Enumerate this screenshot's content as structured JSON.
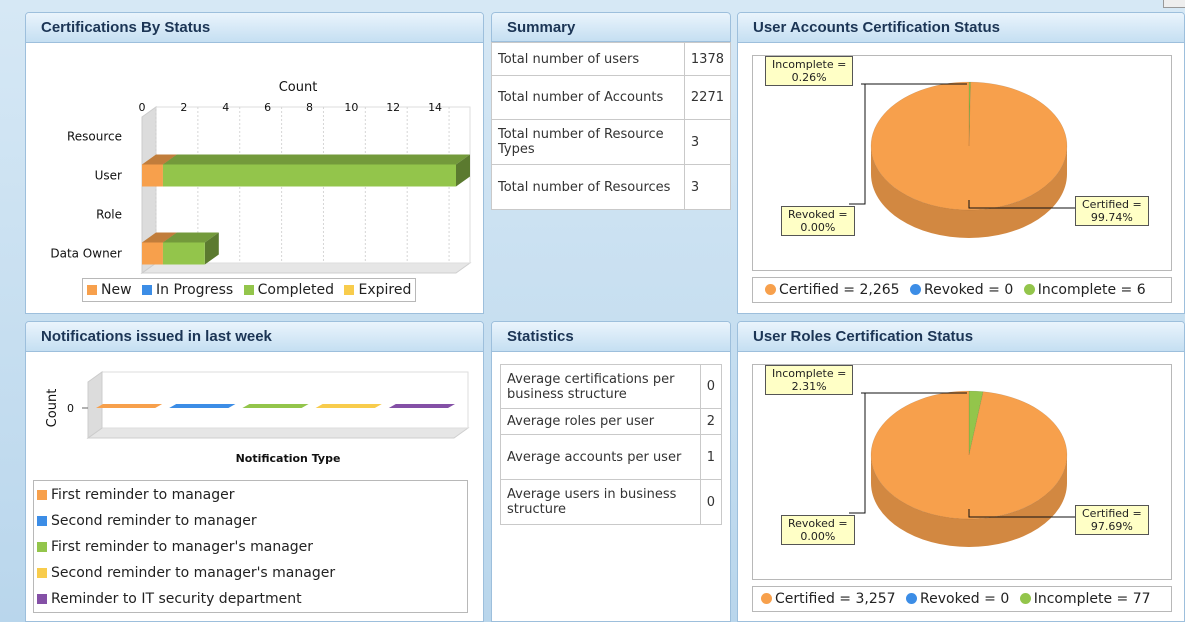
{
  "colors": {
    "new": "#f7a04c",
    "in_progress": "#3c8de6",
    "completed": "#93c54b",
    "expired": "#f8cc4c",
    "it_security": "#8450a6",
    "pie_orange": "#f7a04c",
    "pie_green": "#93c54b",
    "header_text": "#1c3555"
  },
  "cert_panel": {
    "title": "Certifications By Status",
    "legend": [
      {
        "label": "New",
        "color_key": "new"
      },
      {
        "label": "In Progress",
        "color_key": "in_progress"
      },
      {
        "label": "Completed",
        "color_key": "completed"
      },
      {
        "label": "Expired",
        "color_key": "expired"
      }
    ]
  },
  "summary_panel": {
    "title": "Summary",
    "rows": [
      {
        "label": "Total number of users",
        "value": "1378"
      },
      {
        "label": "Total number of Accounts",
        "value": "2271"
      },
      {
        "label": "Total number of Resource Types",
        "value": "3"
      },
      {
        "label": "Total number of Resources",
        "value": "3"
      }
    ]
  },
  "ua_panel": {
    "title": "User Accounts Certification Status",
    "callouts": {
      "incomplete": "Incomplete =\n0.26%",
      "revoked": "Revoked =\n0.00%",
      "certified": "Certified =\n99.74%"
    },
    "legend": [
      {
        "label": "Certified = 2,265",
        "color_key": "pie_orange"
      },
      {
        "label": "Revoked = 0",
        "color_key": "in_progress"
      },
      {
        "label": "Incomplete = 6",
        "color_key": "pie_green"
      }
    ]
  },
  "notif_panel": {
    "title": "Notifications issued in last week",
    "legend": [
      {
        "label": "First reminder to manager",
        "color_key": "new"
      },
      {
        "label": "Second reminder to manager",
        "color_key": "in_progress"
      },
      {
        "label": "First reminder to manager's manager",
        "color_key": "completed"
      },
      {
        "label": "Second reminder to manager's manager",
        "color_key": "expired"
      },
      {
        "label": "Reminder to IT security department",
        "color_key": "it_security"
      }
    ]
  },
  "stats_panel": {
    "title": "Statistics",
    "rows": [
      {
        "label": "Average certifications per business structure",
        "value": "0"
      },
      {
        "label": "Average roles per user",
        "value": "2"
      },
      {
        "label": "Average accounts per user",
        "value": "1"
      },
      {
        "label": "Average users in business structure",
        "value": "0"
      }
    ]
  },
  "ur_panel": {
    "title": "User Roles Certification Status",
    "callouts": {
      "incomplete": "Incomplete =\n2.31%",
      "revoked": "Revoked =\n0.00%",
      "certified": "Certified =\n97.69%"
    },
    "legend": [
      {
        "label": "Certified = 3,257",
        "color_key": "pie_orange"
      },
      {
        "label": "Revoked = 0",
        "color_key": "in_progress"
      },
      {
        "label": "Incomplete = 77",
        "color_key": "pie_green"
      }
    ]
  },
  "chart_data": [
    {
      "type": "bar",
      "orientation": "horizontal",
      "stacked": true,
      "xlabel": "Count",
      "xlim": [
        0,
        15
      ],
      "xticks": [
        0,
        2,
        4,
        6,
        8,
        10,
        12,
        14
      ],
      "categories": [
        "Resource",
        "User",
        "Role",
        "Data Owner"
      ],
      "series": [
        {
          "name": "New",
          "color_key": "new",
          "values": [
            0,
            1,
            0,
            1
          ]
        },
        {
          "name": "In Progress",
          "color_key": "in_progress",
          "values": [
            0,
            0,
            0,
            0
          ]
        },
        {
          "name": "Completed",
          "color_key": "completed",
          "values": [
            0,
            14,
            0,
            2
          ]
        },
        {
          "name": "Expired",
          "color_key": "expired",
          "values": [
            0,
            0,
            0,
            0
          ]
        }
      ],
      "legend_position": "bottom"
    },
    {
      "type": "bar",
      "orientation": "vertical",
      "ylabel": "Count",
      "xlabel": "Notification Type",
      "yticks": [
        0
      ],
      "categories": [
        "First reminder to manager",
        "Second reminder to manager",
        "First reminder to manager's manager",
        "Second reminder to manager's manager",
        "Reminder to IT security department"
      ],
      "values": [
        0,
        0,
        0,
        0,
        0
      ],
      "legend_position": "bottom"
    },
    {
      "type": "pie",
      "labels": [
        "Certified",
        "Revoked",
        "Incomplete"
      ],
      "values": [
        2265,
        0,
        6
      ],
      "percentages": [
        99.74,
        0.0,
        0.26
      ],
      "legend_position": "bottom"
    },
    {
      "type": "pie",
      "labels": [
        "Certified",
        "Revoked",
        "Incomplete"
      ],
      "values": [
        3257,
        0,
        77
      ],
      "percentages": [
        97.69,
        0.0,
        2.31
      ],
      "legend_position": "bottom"
    }
  ]
}
